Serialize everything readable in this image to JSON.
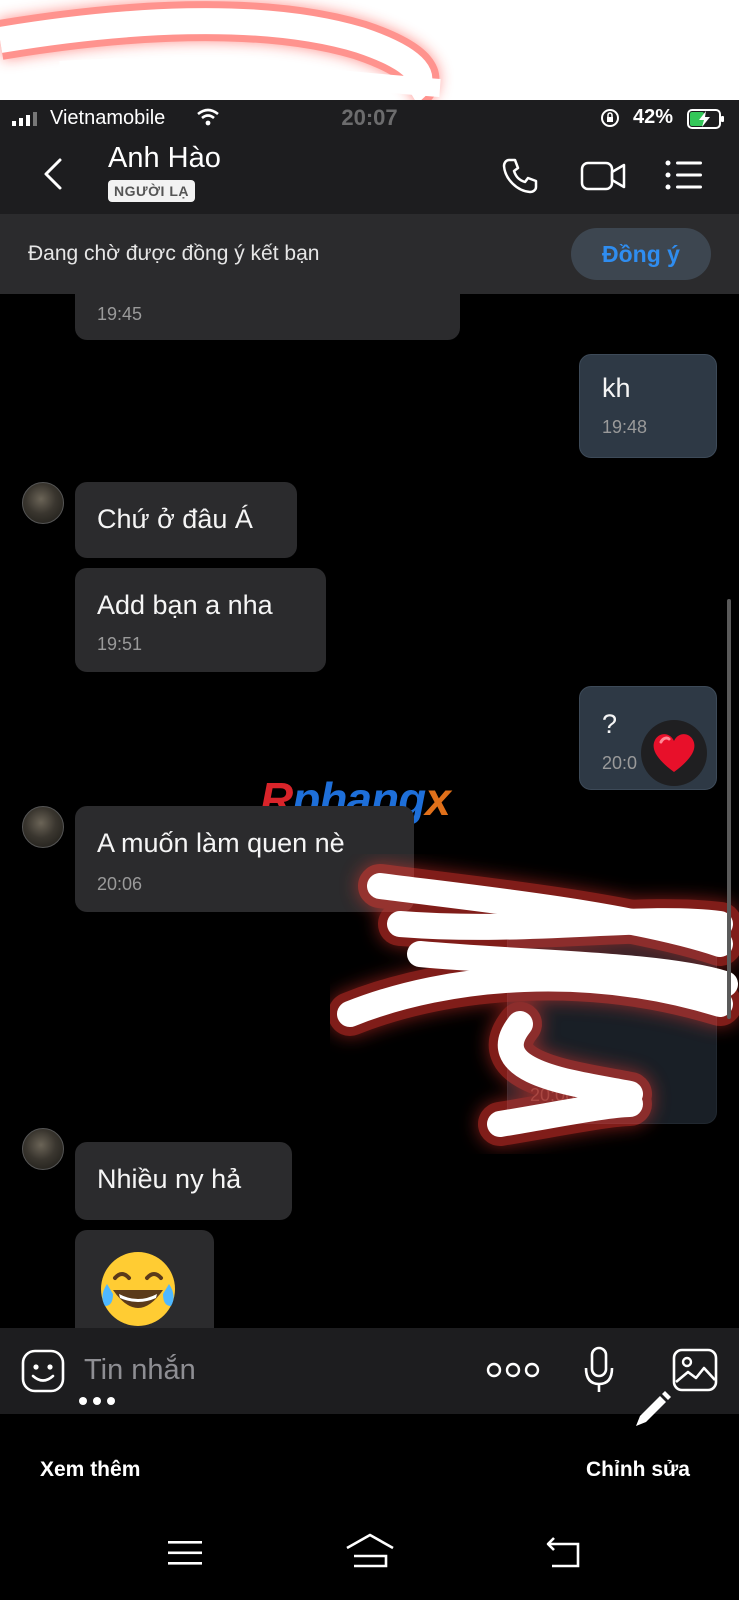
{
  "status_bar": {
    "carrier": "Vietnamobile",
    "time": "20:07",
    "battery_percent": "42%"
  },
  "header": {
    "contact_name": "Anh Hào",
    "badge": "NGƯỜI LẠ"
  },
  "banner": {
    "text": "Đang chờ được đồng ý kết bạn",
    "accept_label": "Đồng ý"
  },
  "messages": [
    {
      "side": "them",
      "text": "",
      "time": "19:45"
    },
    {
      "side": "me",
      "text": "kh",
      "time": "19:48"
    },
    {
      "side": "them",
      "text": "Chứ ở đâu Á",
      "time": ""
    },
    {
      "side": "them",
      "text": "Add bạn a nha",
      "time": "19:51"
    },
    {
      "side": "me",
      "text": "?",
      "time": "20:0",
      "reaction": "heart"
    },
    {
      "side": "them",
      "text": "A muốn làm quen nè",
      "time": "20:06"
    },
    {
      "side": "me",
      "text": "",
      "time": "20:06"
    },
    {
      "side": "them",
      "text": "Nhiều ny hả",
      "time": ""
    },
    {
      "side": "them",
      "text": "",
      "time": "",
      "emoji": "face-with-tears-of-joy"
    }
  ],
  "watermark": {
    "part1": "R",
    "part2": "phang",
    "part3": "x"
  },
  "input": {
    "placeholder": "Tin nhắn"
  },
  "toolbar": {
    "see_more_label": "Xem thêm",
    "edit_label": "Chỉnh sửa"
  },
  "colors": {
    "accent": "#2f8df0",
    "bubble_them": "#2b2b2d",
    "bubble_me": "#2e3945",
    "header_bg": "#1d1d1f"
  }
}
